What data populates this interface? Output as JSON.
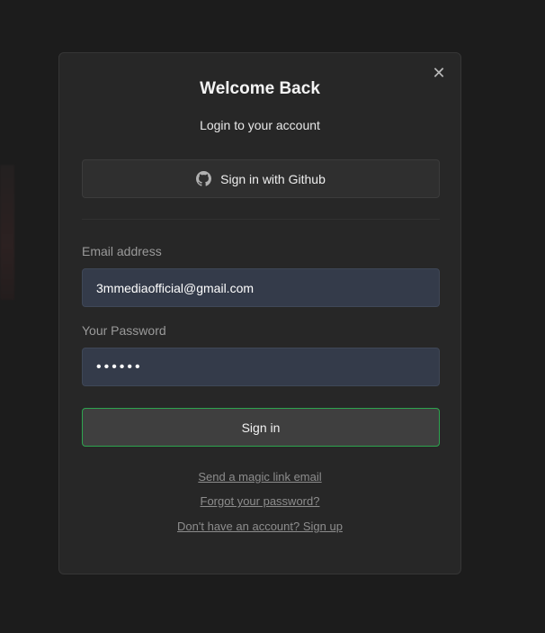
{
  "modal": {
    "title": "Welcome Back",
    "subtitle": "Login to your account",
    "close_icon": "close-icon",
    "close_glyph": "✕"
  },
  "github": {
    "label": "Sign in with Github",
    "icon": "github-icon"
  },
  "email": {
    "label": "Email address",
    "value": "3mmediaofficial@gmail.com"
  },
  "password": {
    "label": "Your Password",
    "value": "••••••"
  },
  "submit": {
    "label": "Sign in",
    "border_color": "#2ea44f"
  },
  "links": {
    "magic": "Send a magic link email",
    "forgot": "Forgot your password?",
    "signup": "Don't have an account? Sign up"
  }
}
